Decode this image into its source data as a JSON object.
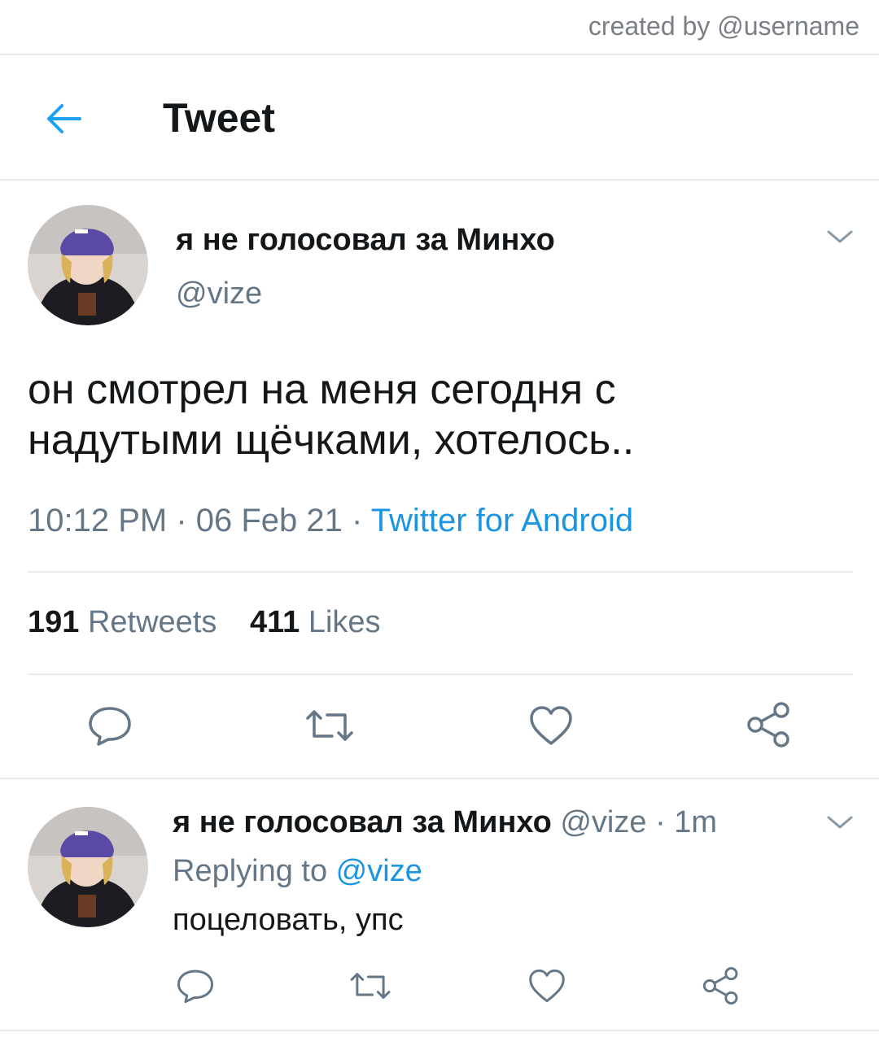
{
  "watermark": "created by @username",
  "header": {
    "title": "Tweet",
    "back_icon": "arrow-left-icon"
  },
  "tweet": {
    "author_name": "я не голосовал за Минхо",
    "author_handle": "@vize",
    "text_line1": "он смотрел на меня сегодня с",
    "text_line2": "надутыми щёчками, хотелось..",
    "time": "10:12 PM",
    "sep1": " · ",
    "date": "06 Feb 21",
    "sep2": " · ",
    "source": "Twitter for Android",
    "retweets_count": "191",
    "retweets_label": "Retweets",
    "likes_count": "411",
    "likes_label": "Likes",
    "actions": [
      "reply-icon",
      "retweet-icon",
      "like-icon",
      "share-icon"
    ]
  },
  "reply": {
    "author_name": "я не голосовал за Минхо",
    "author_handle": "@vize",
    "dot": " · ",
    "time": "1m",
    "replying_label": "Replying to ",
    "replying_to": "@vize",
    "text": "поцеловать, упс"
  },
  "colors": {
    "link": "#1b95e0",
    "muted": "#657786",
    "divider": "#e6ecf0",
    "text": "#14171a"
  }
}
